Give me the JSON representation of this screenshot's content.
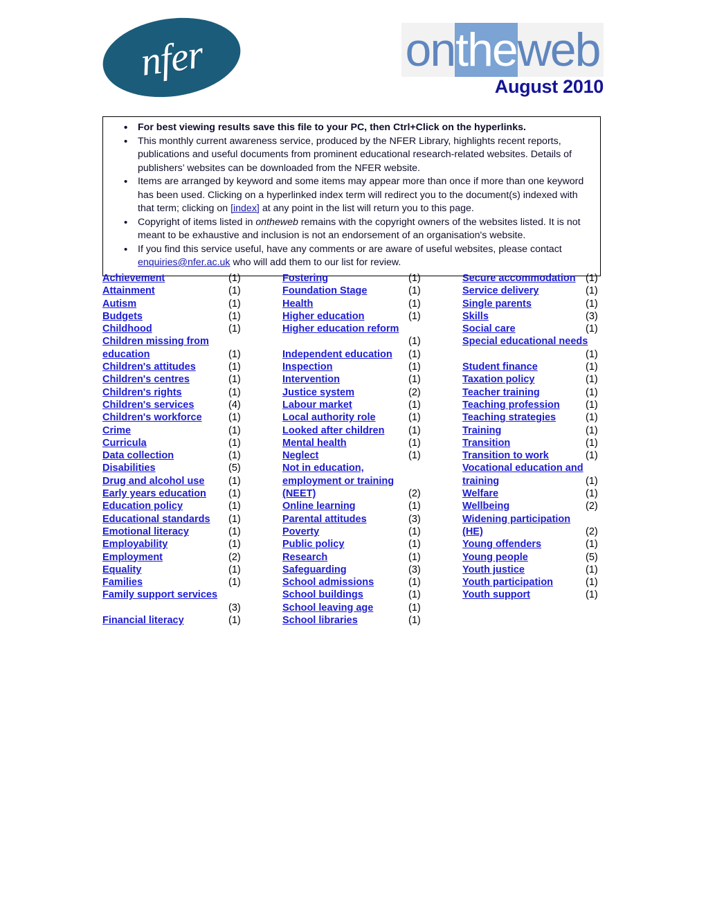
{
  "header": {
    "org_logo_text": "nfer",
    "org_logo_name": "nfer-logo",
    "brand_parts": {
      "a": "on",
      "b": "the",
      "c": "web"
    },
    "brand_full": "ontheweb",
    "issue_date": "August 2010",
    "colors": {
      "nfer_teal": "#1b5c7a",
      "brand_blue": "#5f86bf",
      "brand_highlight": "#7ba3d4",
      "date_navy": "#141496",
      "link_blue": "#1d1dd2"
    }
  },
  "intro": {
    "items": [
      {
        "bold": true,
        "text": "For best viewing results save this file to your PC, then Ctrl+Click on the hyperlinks."
      },
      {
        "bold": false,
        "text": "This monthly current awareness service, produced by the NFER Library, highlights recent reports, publications and useful documents from prominent educational research-related websites. Details of publishers’ websites can be downloaded from the NFER website."
      },
      {
        "bold": false,
        "text_before": "Items are arranged by keyword and some items may appear more than once if more than one keyword has been used. Clicking on a hyperlinked index term will redirect you to the document(s) indexed with that term; clicking on ",
        "link": "[index]",
        "text_after": " at any point in the list will return you to this page."
      },
      {
        "bold": false,
        "text_before": "Copyright of items listed in ",
        "italic": "ontheweb",
        "text_after": " remains with the copyright owners of the websites listed. It is not meant to be exhaustive and inclusion is not an endorsement of an organisation's website."
      },
      {
        "bold": false,
        "text_before": "If you find this service useful, have any comments or are aware of useful websites, please contact ",
        "link": "enquiries@nfer.ac.uk",
        "text_after": " who will add them to our list for review."
      }
    ]
  },
  "index": {
    "columns": [
      {
        "name": "index-column-1",
        "entries": [
          {
            "term": "Achievement",
            "count": "(1)"
          },
          {
            "term": "Attainment",
            "count": "(1)"
          },
          {
            "term": "Autism",
            "count": "(1)"
          },
          {
            "term": "Budgets",
            "count": "(1)"
          },
          {
            "term": "Childhood",
            "count": "(1)"
          },
          {
            "term": "Children missing from ",
            "term2": "education",
            "count": "(1)",
            "wrapped": true
          },
          {
            "term": "Children's attitudes",
            "count": "(1)"
          },
          {
            "term": "Children's centres",
            "count": "(1)"
          },
          {
            "term": "Children's rights",
            "count": "(1)"
          },
          {
            "term": "Children's services",
            "count": "(4)"
          },
          {
            "term": "Children's workforce",
            "count": "(1)"
          },
          {
            "term": "Crime",
            "count": "(1)"
          },
          {
            "term": "Curricula",
            "count": "(1)"
          },
          {
            "term": "Data collection",
            "count": "(1)"
          },
          {
            "term": "Disabilities",
            "count": "(5)"
          },
          {
            "term": "Drug and alcohol use",
            "count": "(1)"
          },
          {
            "term": "Early years education",
            "count": "(1)"
          },
          {
            "term": "Education policy",
            "count": "(1)"
          },
          {
            "term": "Educational standards",
            "count": "(1)"
          },
          {
            "term": "Emotional literacy",
            "count": "(1)"
          },
          {
            "term": "Employability",
            "count": "(1)"
          },
          {
            "term": "Employment",
            "count": "(2)"
          },
          {
            "term": "Equality",
            "count": "(1)"
          },
          {
            "term": "Families",
            "count": "(1)"
          },
          {
            "term": "Family support services",
            "count": "(3)",
            "count_on_next_line": true
          },
          {
            "term": "Financial literacy",
            "count": "(1)"
          }
        ]
      },
      {
        "name": "index-column-2",
        "entries": [
          {
            "term": "Fostering",
            "count": "(1)"
          },
          {
            "term": "Foundation Stage",
            "count": "(1)"
          },
          {
            "term": "Health",
            "count": "(1)"
          },
          {
            "term": "Higher education",
            "count": "(1)"
          },
          {
            "term": "Higher education reform",
            "count": "(1)",
            "count_on_next_line": true
          },
          {
            "term": "Independent education",
            "count": "(1)"
          },
          {
            "term": "Inspection",
            "count": "(1)"
          },
          {
            "term": "Intervention",
            "count": "(1)"
          },
          {
            "term": "Justice system",
            "count": "(2)"
          },
          {
            "term": "Labour market",
            "count": "(1)"
          },
          {
            "term": "Local authority role",
            "count": "(1)"
          },
          {
            "term": "Looked after children",
            "count": "(1)"
          },
          {
            "term": "Mental health",
            "count": "(1)"
          },
          {
            "term": "Neglect",
            "count": "(1)"
          },
          {
            "term": "Not in education, ",
            "term2": "employment or training ",
            "term3": "(NEET)",
            "count": "(2)",
            "wrapped3": true
          },
          {
            "term": "Online learning",
            "count": "(1)"
          },
          {
            "term": "Parental attitudes",
            "count": "(3)"
          },
          {
            "term": "Poverty",
            "count": "(1)"
          },
          {
            "term": "Public policy",
            "count": "(1)"
          },
          {
            "term": "Research",
            "count": "(1)"
          },
          {
            "term": "Safeguarding",
            "count": "(3)"
          },
          {
            "term": "School admissions",
            "count": "(1)"
          },
          {
            "term": "School buildings",
            "count": "(1)"
          },
          {
            "term": "School leaving age",
            "count": "(1)"
          },
          {
            "term": "School libraries",
            "count": "(1)"
          }
        ]
      },
      {
        "name": "index-column-3",
        "entries": [
          {
            "term": "Secure accommodation",
            "count": "(1)"
          },
          {
            "term": "Service delivery",
            "count": "(1)"
          },
          {
            "term": "Single parents",
            "count": "(1)"
          },
          {
            "term": "Skills",
            "count": "(3)"
          },
          {
            "term": "Social care",
            "count": "(1)"
          },
          {
            "term": "Special educational needs",
            "count": "(1)",
            "count_on_next_line": true
          },
          {
            "term": "Student finance",
            "count": "(1)"
          },
          {
            "term": "Taxation policy",
            "count": "(1)"
          },
          {
            "term": "Teacher training",
            "count": "(1)"
          },
          {
            "term": "Teaching profession",
            "count": "(1)"
          },
          {
            "term": "Teaching strategies",
            "count": "(1)"
          },
          {
            "term": "Training",
            "count": "(1)"
          },
          {
            "term": "Transition",
            "count": "(1)"
          },
          {
            "term": "Transition to work",
            "count": "(1)"
          },
          {
            "term": "Vocational education and ",
            "term2": "training",
            "count": "(1)",
            "wrapped": true
          },
          {
            "term": "Welfare",
            "count": "(1)"
          },
          {
            "term": "Wellbeing",
            "count": "(2)"
          },
          {
            "term": "Widening participation ",
            "term2": "(HE)",
            "count": "(2)",
            "wrapped": true
          },
          {
            "term": "Young offenders",
            "count": "(1)"
          },
          {
            "term": "Young people",
            "count": "(5)"
          },
          {
            "term": "Youth justice",
            "count": "(1)"
          },
          {
            "term": "Youth participation",
            "count": "(1)"
          },
          {
            "term": "Youth support",
            "count": "(1)"
          }
        ]
      }
    ]
  }
}
